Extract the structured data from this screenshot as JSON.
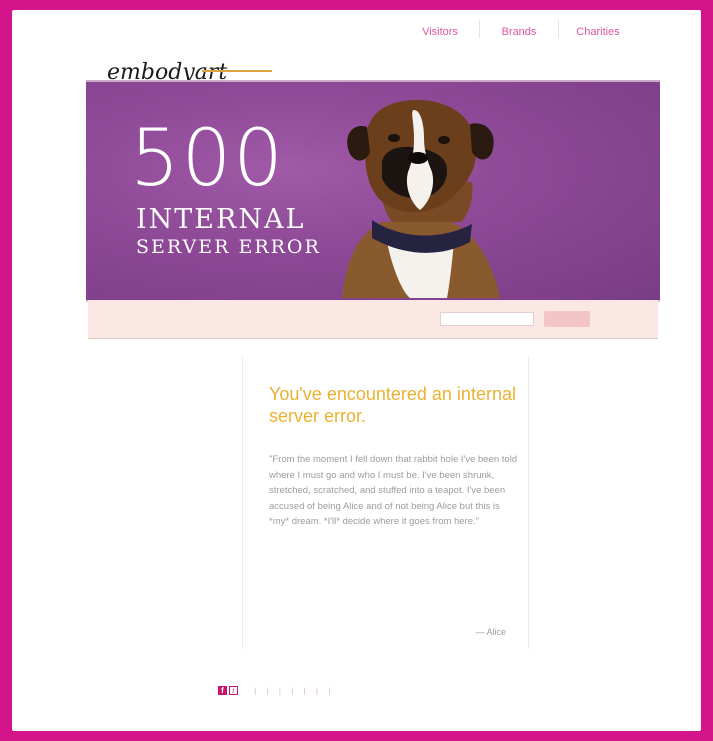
{
  "nav": {
    "items": [
      {
        "top_label": "",
        "link_label": "Visitors"
      },
      {
        "top_label": "",
        "link_label": "Brands"
      },
      {
        "top_label": "",
        "link_label": "Charities"
      }
    ]
  },
  "logo": {
    "text": "embodyart"
  },
  "banner": {
    "code": "500",
    "line1": "INTERNAL",
    "line2": "SERVER ERROR"
  },
  "strip": {
    "text": "",
    "input_value": "",
    "button_label": ""
  },
  "content": {
    "heading": "You've encountered an internal server error.",
    "quote": "\"From the moment I fell down that rabbit hole I've been told where I must go and who I must be. I've been shrunk, stretched, scratched, and stuffed into a teapot. I've been accused of being Alice and of not being Alice but this is *my* dream. *I'll* decide where it goes from here.\"",
    "signature": "— Alice"
  },
  "footer": {
    "items": [
      "",
      "",
      "",
      "",
      "",
      "",
      "",
      "",
      ""
    ]
  },
  "colors": {
    "frame": "#d3148a",
    "banner": "#8f4a98",
    "heading": "#ebb130",
    "link": "#e0569e"
  }
}
